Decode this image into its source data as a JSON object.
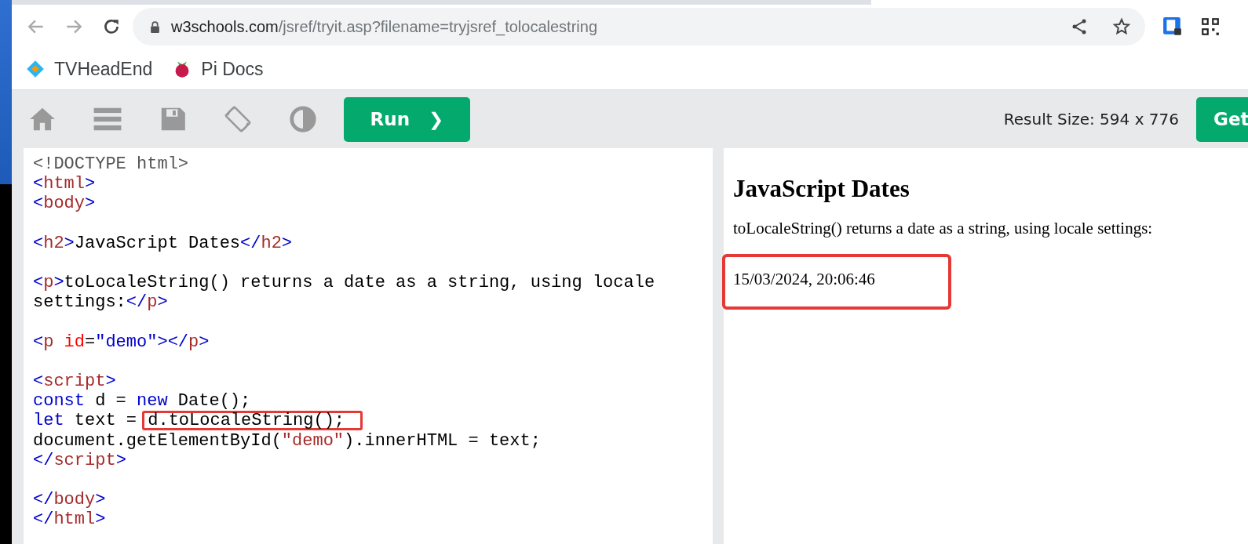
{
  "address_bar": {
    "url_host": "w3schools.com",
    "url_path": "/jsref/tryit.asp?filename=tryjsref_tolocalestring"
  },
  "bookmarks": [
    {
      "label": "TVHeadEnd",
      "kind": "tvheadend"
    },
    {
      "label": "Pi Docs",
      "kind": "raspberry"
    }
  ],
  "toolbar": {
    "run_button": "Run",
    "run_arrow": "❯",
    "result_size": "Result Size: 594 x 776",
    "get_button": "Get"
  },
  "code_lines": [
    {
      "tokens": [
        {
          "kind": "doctype",
          "text": "<!DOCTYPE html>"
        }
      ]
    },
    {
      "tokens": [
        {
          "kind": "bracket",
          "text": "<"
        },
        {
          "kind": "tag",
          "text": "html"
        },
        {
          "kind": "bracket",
          "text": ">"
        }
      ]
    },
    {
      "tokens": [
        {
          "kind": "bracket",
          "text": "<"
        },
        {
          "kind": "tag",
          "text": "body"
        },
        {
          "kind": "bracket",
          "text": ">"
        }
      ]
    },
    {
      "gap_before": true,
      "tokens": [
        {
          "kind": "bracket",
          "text": "<"
        },
        {
          "kind": "tag",
          "text": "h2"
        },
        {
          "kind": "bracket",
          "text": ">"
        },
        {
          "kind": "plain",
          "text": "JavaScript Dates"
        },
        {
          "kind": "bracket",
          "text": "</"
        },
        {
          "kind": "tag",
          "text": "h2"
        },
        {
          "kind": "bracket",
          "text": ">"
        }
      ]
    },
    {
      "gap_before": true,
      "tokens": [
        {
          "kind": "bracket",
          "text": "<"
        },
        {
          "kind": "tag",
          "text": "p"
        },
        {
          "kind": "bracket",
          "text": ">"
        },
        {
          "kind": "plain",
          "text": "toLocaleString() returns a date as a string, using locale"
        }
      ]
    },
    {
      "tokens": [
        {
          "kind": "plain",
          "text": "settings:"
        },
        {
          "kind": "bracket",
          "text": "</"
        },
        {
          "kind": "tag",
          "text": "p"
        },
        {
          "kind": "bracket",
          "text": ">"
        }
      ]
    },
    {
      "gap_before": true,
      "tokens": [
        {
          "kind": "bracket",
          "text": "<"
        },
        {
          "kind": "tag",
          "text": "p"
        },
        {
          "kind": "attr",
          "text": " id"
        },
        {
          "kind": "plain",
          "text": "="
        },
        {
          "kind": "value",
          "text": "\"demo\""
        },
        {
          "kind": "bracket",
          "text": "></"
        },
        {
          "kind": "tag",
          "text": "p"
        },
        {
          "kind": "bracket",
          "text": ">"
        }
      ]
    },
    {
      "gap_before": true,
      "tokens": [
        {
          "kind": "bracket",
          "text": "<"
        },
        {
          "kind": "tag",
          "text": "script"
        },
        {
          "kind": "bracket",
          "text": ">"
        }
      ]
    },
    {
      "tokens": [
        {
          "kind": "keyword",
          "text": "const"
        },
        {
          "kind": "plain",
          "text": " d = "
        },
        {
          "kind": "keyword",
          "text": "new"
        },
        {
          "kind": "plain",
          "text": " Date();"
        }
      ]
    },
    {
      "tokens": [
        {
          "kind": "keyword",
          "text": "let"
        },
        {
          "kind": "plain",
          "text": " text = "
        },
        {
          "kind": "boxed",
          "text": "d.toLocaleString();"
        }
      ]
    },
    {
      "tokens": [
        {
          "kind": "plain",
          "text": "document.getElementById("
        },
        {
          "kind": "string",
          "text": "\"demo\""
        },
        {
          "kind": "plain",
          "text": ").innerHTML = text;"
        }
      ]
    },
    {
      "tokens": [
        {
          "kind": "bracket",
          "text": "</"
        },
        {
          "kind": "tag",
          "text": "script"
        },
        {
          "kind": "bracket",
          "text": ">"
        }
      ]
    },
    {
      "gap_before": true,
      "tokens": [
        {
          "kind": "bracket",
          "text": "</"
        },
        {
          "kind": "tag",
          "text": "body"
        },
        {
          "kind": "bracket",
          "text": ">"
        }
      ]
    },
    {
      "tokens": [
        {
          "kind": "bracket",
          "text": "</"
        },
        {
          "kind": "tag",
          "text": "html"
        },
        {
          "kind": "bracket",
          "text": ">"
        }
      ]
    }
  ],
  "result": {
    "heading": "JavaScript Dates",
    "paragraph": "toLocaleString() returns a date as a string, using locale settings:",
    "output": "15/03/2024, 20:06:46",
    "output_boxed": true
  }
}
